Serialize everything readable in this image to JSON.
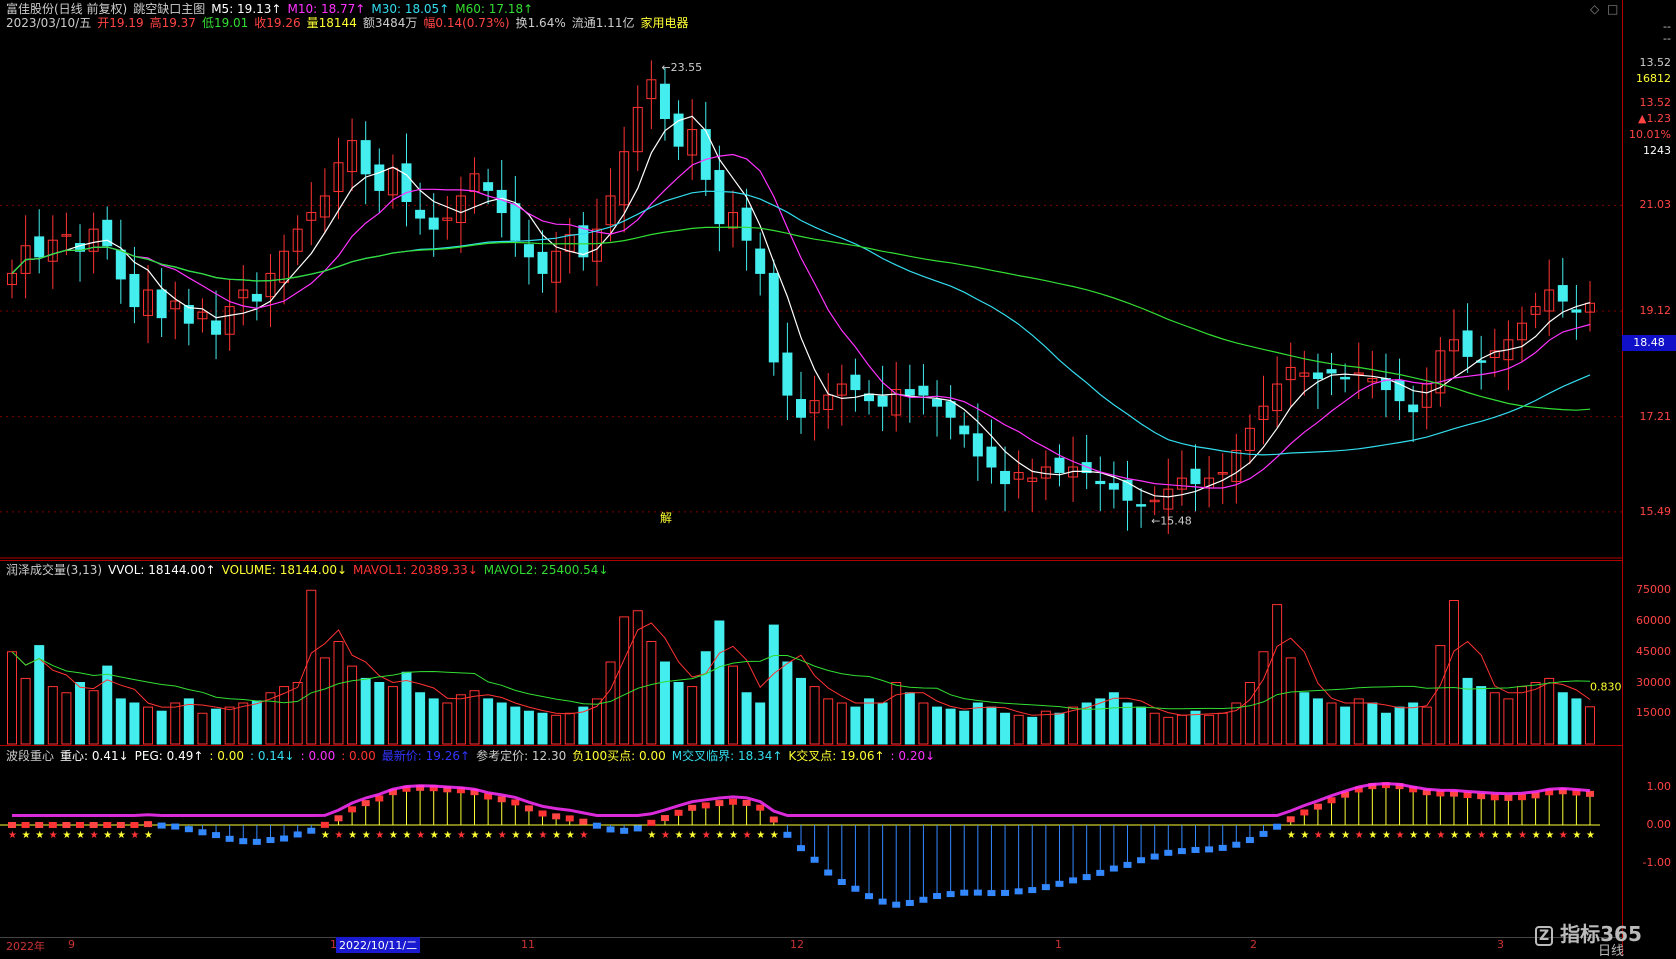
{
  "main_header": {
    "line1": [
      {
        "text": "富佳股份(日线 前复权)",
        "color": "#cccccc"
      },
      {
        "text": "跳空缺口主图",
        "color": "#cccccc"
      },
      {
        "text": "M5: 19.13↑",
        "color": "#ffffff"
      },
      {
        "text": "M10: 18.77↑",
        "color": "#ff33ff"
      },
      {
        "text": "M30: 18.05↑",
        "color": "#33ddee"
      },
      {
        "text": "M60: 17.18↑",
        "color": "#33dd33"
      }
    ],
    "line2": [
      {
        "text": "2023/03/10/五",
        "color": "#cccccc"
      },
      {
        "text": "开19.19",
        "color": "#ff4444"
      },
      {
        "text": "高19.37",
        "color": "#ff4444"
      },
      {
        "text": "低19.01",
        "color": "#33dd33"
      },
      {
        "text": "收19.26",
        "color": "#ff4444"
      },
      {
        "text": "量18144",
        "color": "#ffff33"
      },
      {
        "text": "额3484万",
        "color": "#cccccc"
      },
      {
        "text": "幅0.14(0.73%)",
        "color": "#ff4444"
      },
      {
        "text": "换1.64%",
        "color": "#cccccc"
      },
      {
        "text": "流通1.11亿",
        "color": "#cccccc"
      },
      {
        "text": "家用电器",
        "color": "#ffff33"
      }
    ]
  },
  "vol_header": [
    {
      "text": "润泽成交量(3,13)",
      "color": "#cccccc"
    },
    {
      "text": "VVOL: 18144.00↑",
      "color": "#ffffff"
    },
    {
      "text": "VOLUME: 18144.00↓",
      "color": "#ffff33"
    },
    {
      "text": "MAVOL1: 20389.33↓",
      "color": "#ff3333"
    },
    {
      "text": "MAVOL2: 25400.54↓",
      "color": "#33dd33"
    }
  ],
  "osc_header": [
    {
      "text": "波段重心",
      "color": "#cccccc"
    },
    {
      "text": "重心: 0.41↓",
      "color": "#ffffff"
    },
    {
      "text": "PEG: 0.49↑",
      "color": "#ffffff"
    },
    {
      "text": ": 0.00",
      "color": "#ffff33"
    },
    {
      "text": ": 0.14↓",
      "color": "#33ddee"
    },
    {
      "text": ": 0.00",
      "color": "#ff33ff"
    },
    {
      "text": ": 0.00",
      "color": "#ff3333"
    },
    {
      "text": "最新价: 19.26↑",
      "color": "#3333ff"
    },
    {
      "text": "参考定价: 12.30",
      "color": "#cccccc"
    },
    {
      "text": "负100买点: 0.00",
      "color": "#ffff33"
    },
    {
      "text": "M交叉临界: 18.34↑",
      "color": "#33ddee"
    },
    {
      "text": "K交叉点: 19.06↑",
      "color": "#ffff33"
    },
    {
      "text": ": 0.20↓",
      "color": "#ff33ff"
    }
  ],
  "right_axis": {
    "top_info": [
      "--",
      "--",
      "13.52",
      "16812",
      "13.52",
      "▲1.23",
      "10.01%",
      "1243"
    ],
    "price_ticks": [
      "21.03",
      "19.12",
      "17.21",
      "15.49"
    ],
    "current_price": "18.48",
    "vol_ticks": [
      "75000",
      "60000",
      "45000",
      "30000",
      "15000"
    ],
    "osc_ticks": [
      "1.00",
      "0.00",
      "-1.00"
    ]
  },
  "annotations": {
    "high_label": "23.55",
    "low_label": "15.48",
    "gap_label": "解",
    "vol_last": "0.830"
  },
  "time_axis": {
    "labels": [
      "2022年",
      "9",
      "10",
      "11",
      "12",
      "1",
      "2",
      "3"
    ],
    "selected": "2022/10/11/二"
  },
  "brand": {
    "logo": "指标365",
    "sub": "日线"
  },
  "colors": {
    "up": "#ff3333",
    "down": "#44eeee",
    "ma5": "#ffffff",
    "ma10": "#ff33ff",
    "ma30": "#33ddee",
    "ma60": "#33dd33"
  },
  "chart_data": {
    "type": "candlestick",
    "closes": [
      19.8,
      20.3,
      20.1,
      20.4,
      20.5,
      20.2,
      20.6,
      20.3,
      19.7,
      19.2,
      19.5,
      19.0,
      19.3,
      18.9,
      19.1,
      18.7,
      19.2,
      19.5,
      19.3,
      19.8,
      20.2,
      20.6,
      20.9,
      21.2,
      21.8,
      22.2,
      21.6,
      21.3,
      21.7,
      21.1,
      20.8,
      20.6,
      20.8,
      21.2,
      21.6,
      21.3,
      20.9,
      20.4,
      20.1,
      19.8,
      20.2,
      20.5,
      20.1,
      20.6,
      21.2,
      22.0,
      22.8,
      23.3,
      22.6,
      22.1,
      22.4,
      21.5,
      20.7,
      20.9,
      20.4,
      19.8,
      18.2,
      17.6,
      17.2,
      17.5,
      17.6,
      17.8,
      17.7,
      17.5,
      17.4,
      17.7,
      17.6,
      17.6,
      17.4,
      17.2,
      16.9,
      16.5,
      16.3,
      16.0,
      16.2,
      16.1,
      16.3,
      16.2,
      16.3,
      16.2,
      16.0,
      15.9,
      15.7,
      15.6,
      15.7,
      15.9,
      16.1,
      16.0,
      16.1,
      16.2,
      16.6,
      17.0,
      17.4,
      17.8,
      18.1,
      18.0,
      17.9,
      18.0,
      17.9,
      18.0,
      17.9,
      17.7,
      17.5,
      17.3,
      17.8,
      18.4,
      18.6,
      18.3,
      18.2,
      18.4,
      18.6,
      18.9,
      19.2,
      19.5,
      19.3,
      19.1,
      19.26
    ],
    "ma_periods": [
      5,
      10,
      30,
      60
    ],
    "volumes": [
      45000,
      32000,
      48000,
      28000,
      25000,
      30000,
      26000,
      38000,
      22000,
      20000,
      18000,
      16000,
      20000,
      22000,
      15000,
      17000,
      18000,
      20000,
      21000,
      25000,
      28000,
      30000,
      75000,
      42000,
      50000,
      38000,
      32000,
      30000,
      28000,
      35000,
      25000,
      22000,
      20000,
      24000,
      26000,
      22000,
      20000,
      18000,
      16000,
      15000,
      14000,
      15000,
      18000,
      22000,
      40000,
      62000,
      65000,
      50000,
      40000,
      30000,
      28000,
      45000,
      60000,
      38000,
      25000,
      20000,
      58000,
      40000,
      32000,
      28000,
      22000,
      20000,
      18000,
      22000,
      20000,
      30000,
      25000,
      20000,
      18000,
      17000,
      16000,
      20000,
      18000,
      15000,
      14000,
      13000,
      16000,
      15000,
      18000,
      20000,
      22000,
      25000,
      20000,
      18000,
      15000,
      13000,
      14000,
      16000,
      14000,
      15000,
      20000,
      30000,
      45000,
      68000,
      42000,
      25000,
      22000,
      20000,
      18000,
      22000,
      20000,
      15000,
      18000,
      20000,
      18000,
      48000,
      70000,
      32000,
      28000,
      25000,
      22000,
      28000,
      30000,
      32000,
      25000,
      22000,
      18144
    ]
  }
}
